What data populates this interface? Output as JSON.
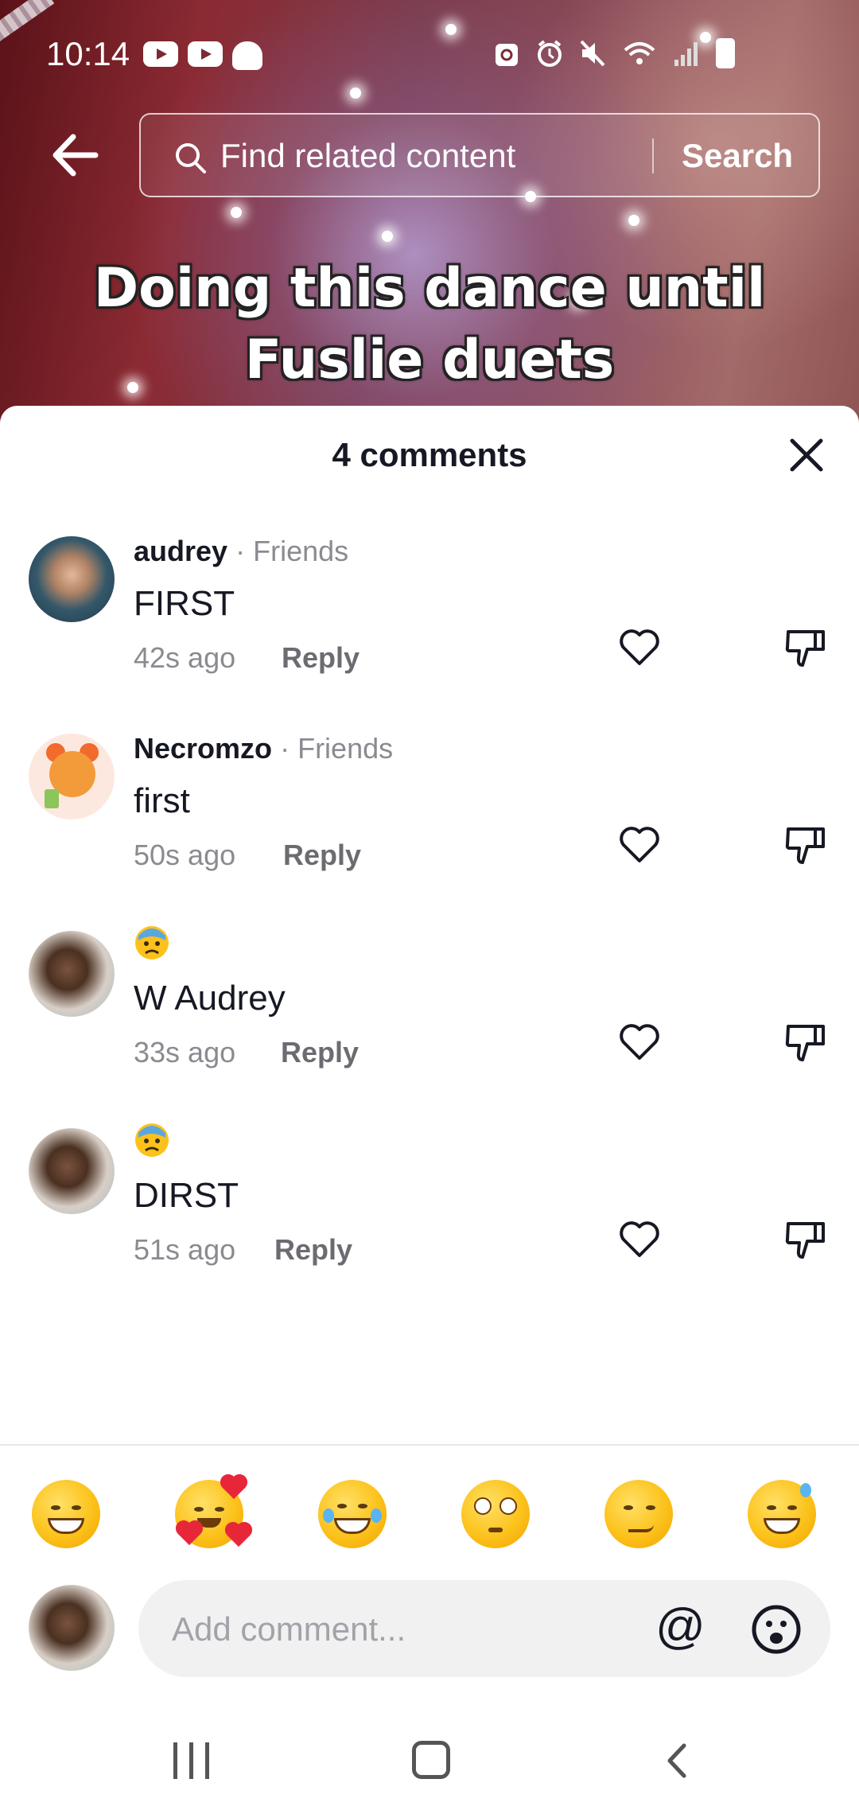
{
  "status_bar": {
    "time": "10:14"
  },
  "search": {
    "placeholder": "Find related content",
    "button_label": "Search"
  },
  "video": {
    "caption": "Doing this dance until Fuslie duets"
  },
  "sheet": {
    "title": "4 comments"
  },
  "comments": [
    {
      "user": "audrey",
      "separator": "·",
      "tag": "Friends",
      "text": "FIRST",
      "time": "42s ago",
      "reply": "Reply",
      "avatar": "audrey-avatar"
    },
    {
      "user": "Necromzo",
      "separator": "·",
      "tag": "Friends",
      "text": "first",
      "time": "50s ago",
      "reply": "Reply",
      "avatar": "necromzo-avatar"
    },
    {
      "user_emoji": "anxious-face-emoji",
      "text": "W Audrey",
      "time": "33s ago",
      "reply": "Reply",
      "avatar": "cat-avatar"
    },
    {
      "user_emoji": "anxious-face-emoji",
      "text": "DIRST",
      "time": "51s ago",
      "reply": "Reply",
      "avatar": "cat-avatar"
    }
  ],
  "quick_emojis": [
    "grinning-face",
    "smiling-face-with-hearts",
    "tears-of-joy",
    "flushed-face",
    "smirking-face",
    "grinning-sweat"
  ],
  "composer": {
    "placeholder": "Add comment...",
    "mention_label": "@"
  },
  "colors": {
    "like_icon": "#161823",
    "secondary_text": "#8a8b91",
    "input_bg": "#f1f1f2"
  }
}
